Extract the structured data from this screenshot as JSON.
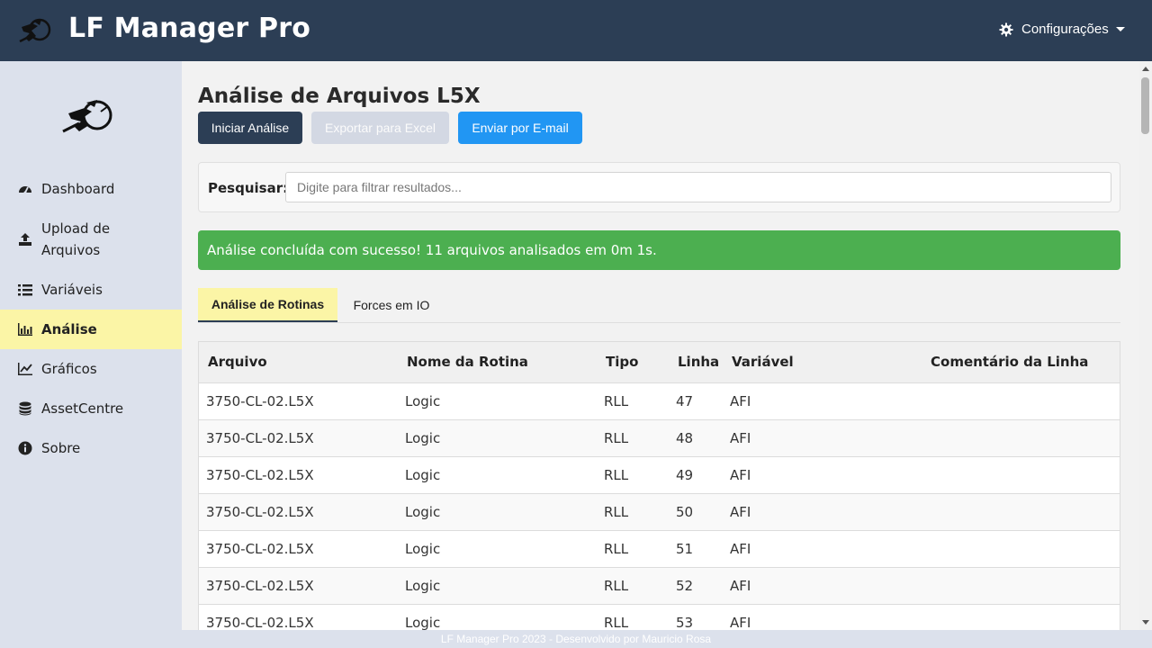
{
  "header": {
    "app_title": "LF Manager Pro",
    "config_label": "Configurações"
  },
  "sidebar": {
    "items": [
      {
        "label": "Dashboard",
        "icon": "dashboard-icon"
      },
      {
        "label": "Upload de Arquivos",
        "icon": "upload-icon"
      },
      {
        "label": "Variáveis",
        "icon": "list-icon"
      },
      {
        "label": "Análise",
        "icon": "bar-chart-icon",
        "active": true
      },
      {
        "label": "Gráficos",
        "icon": "line-chart-icon"
      },
      {
        "label": "AssetCentre",
        "icon": "database-icon"
      },
      {
        "label": "Sobre",
        "icon": "info-icon"
      }
    ]
  },
  "main": {
    "page_title": "Análise de Arquivos L5X",
    "buttons": {
      "start": "Iniciar Análise",
      "export": "Exportar para Excel",
      "email": "Enviar por E-mail"
    },
    "search": {
      "label": "Pesquisar:",
      "placeholder": "Digite para filtrar resultados...",
      "value": ""
    },
    "alert": "Análise concluída com sucesso! 11 arquivos analisados em 0m 1s.",
    "tabs": [
      "Análise de Rotinas",
      "Forces em IO"
    ],
    "table": {
      "columns": [
        "Arquivo",
        "Nome da Rotina",
        "Tipo",
        "Linha",
        "Variável",
        "Comentário da Linha"
      ],
      "rows": [
        [
          "3750-CL-02.L5X",
          "Logic",
          "RLL",
          "47",
          "AFI",
          ""
        ],
        [
          "3750-CL-02.L5X",
          "Logic",
          "RLL",
          "48",
          "AFI",
          ""
        ],
        [
          "3750-CL-02.L5X",
          "Logic",
          "RLL",
          "49",
          "AFI",
          ""
        ],
        [
          "3750-CL-02.L5X",
          "Logic",
          "RLL",
          "50",
          "AFI",
          ""
        ],
        [
          "3750-CL-02.L5X",
          "Logic",
          "RLL",
          "51",
          "AFI",
          ""
        ],
        [
          "3750-CL-02.L5X",
          "Logic",
          "RLL",
          "52",
          "AFI",
          ""
        ],
        [
          "3750-CL-02.L5X",
          "Logic",
          "RLL",
          "53",
          "AFI",
          ""
        ]
      ]
    }
  },
  "footer": "LF Manager Pro 2023 - Desenvolvido por Mauricio Rosa",
  "colors": {
    "header_bg": "#2c3e55",
    "sidebar_bg": "#dce1ec",
    "active_highlight": "#fbf5a6",
    "success": "#4caf50",
    "email_button": "#2196f3"
  }
}
